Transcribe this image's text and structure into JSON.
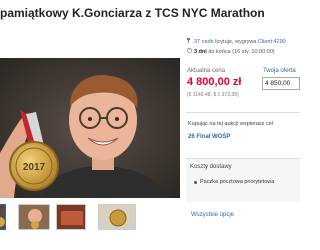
{
  "listing": {
    "title": "pamiątkowy K.Gonciarza z TCS NYC Marathon"
  },
  "meta": {
    "watchers_count": "37 osób",
    "watchers_suffix": "licytuje, wygrywa",
    "client": "Client:4290",
    "days_left": "3 dni",
    "days_suffix": "do końca (16 sty, 10:00:00)"
  },
  "price": {
    "label": "Aktualna cena",
    "value": "4 800,00 zł",
    "converted": "(€ 1149.48, $ 1 373,39)",
    "offer_label": "Twoja oferta",
    "offer_value": "4 850,00"
  },
  "support": {
    "text": "Kupując na tej aukcji wspierasz cel",
    "cause": "26 Finał WOŚP"
  },
  "shipping": {
    "heading": "Koszty dostawy",
    "items": [
      "Paczka pocztowa priorytetowa"
    ],
    "all_options": "Wszystkie opcje"
  },
  "photo": {
    "medal_text": "2017"
  },
  "thumbnails": [
    "thumb-1",
    "thumb-2",
    "thumb-3",
    "thumb-4"
  ],
  "colors": {
    "price": "#e4002b",
    "link": "#2f6aa6"
  }
}
